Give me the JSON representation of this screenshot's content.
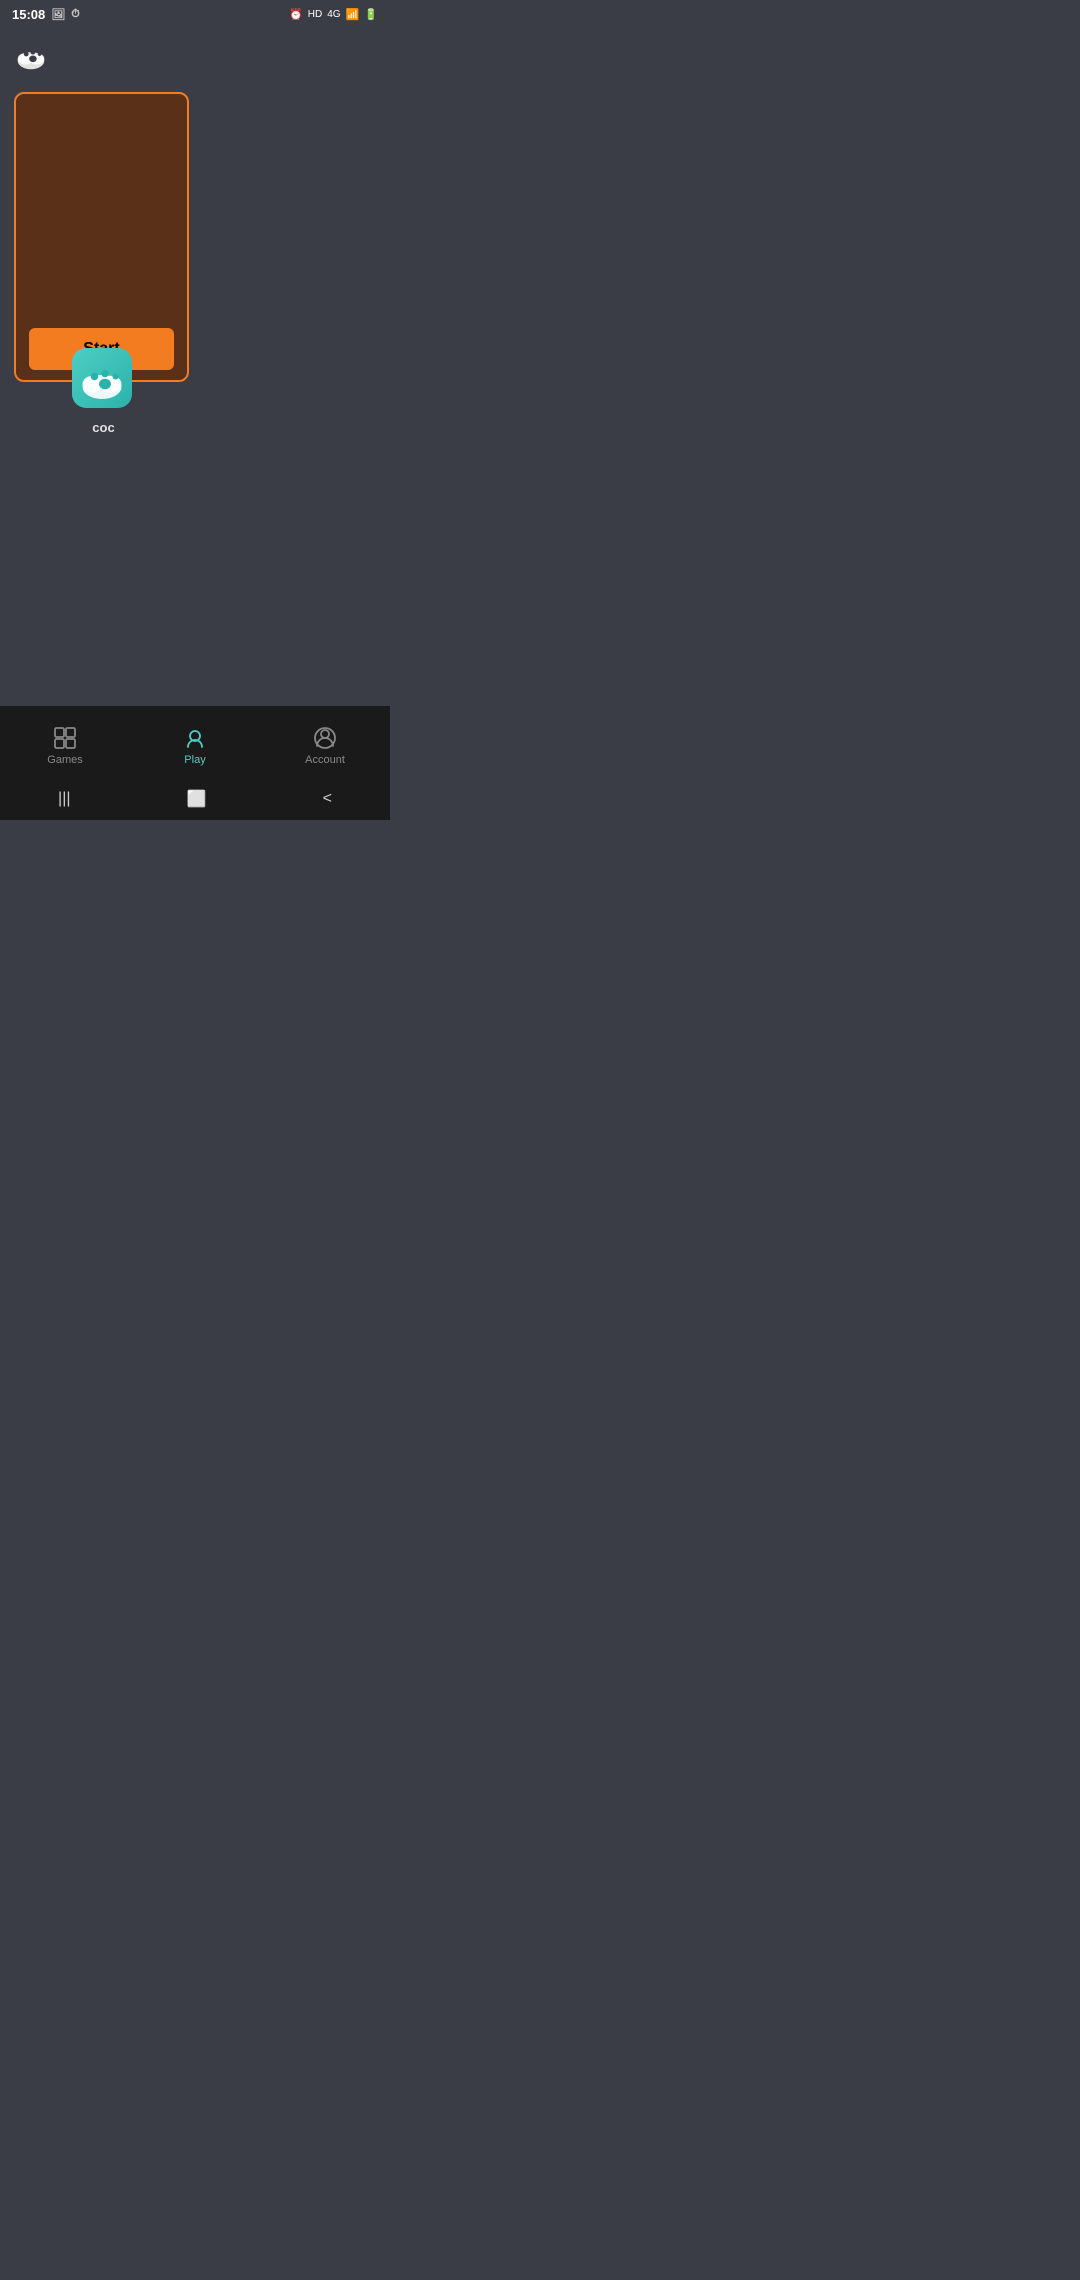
{
  "statusBar": {
    "time": "15:08",
    "batteryIcon": "🔋",
    "signalBars": "▌▌▌",
    "networkType": "4G",
    "hdLabel": "HD",
    "alarmIcon": "⏰"
  },
  "header": {
    "logoAlt": "paw cloud logo"
  },
  "gameCard": {
    "startButtonLabel": "Start",
    "gameLabel": "coc"
  },
  "bottomNav": {
    "items": [
      {
        "id": "games",
        "label": "Games",
        "active": false
      },
      {
        "id": "play",
        "label": "Play",
        "active": true
      },
      {
        "id": "account",
        "label": "Account",
        "active": false
      }
    ]
  },
  "androidNav": {
    "recentIcon": "|||",
    "homeIcon": "⬜",
    "backIcon": "<"
  }
}
